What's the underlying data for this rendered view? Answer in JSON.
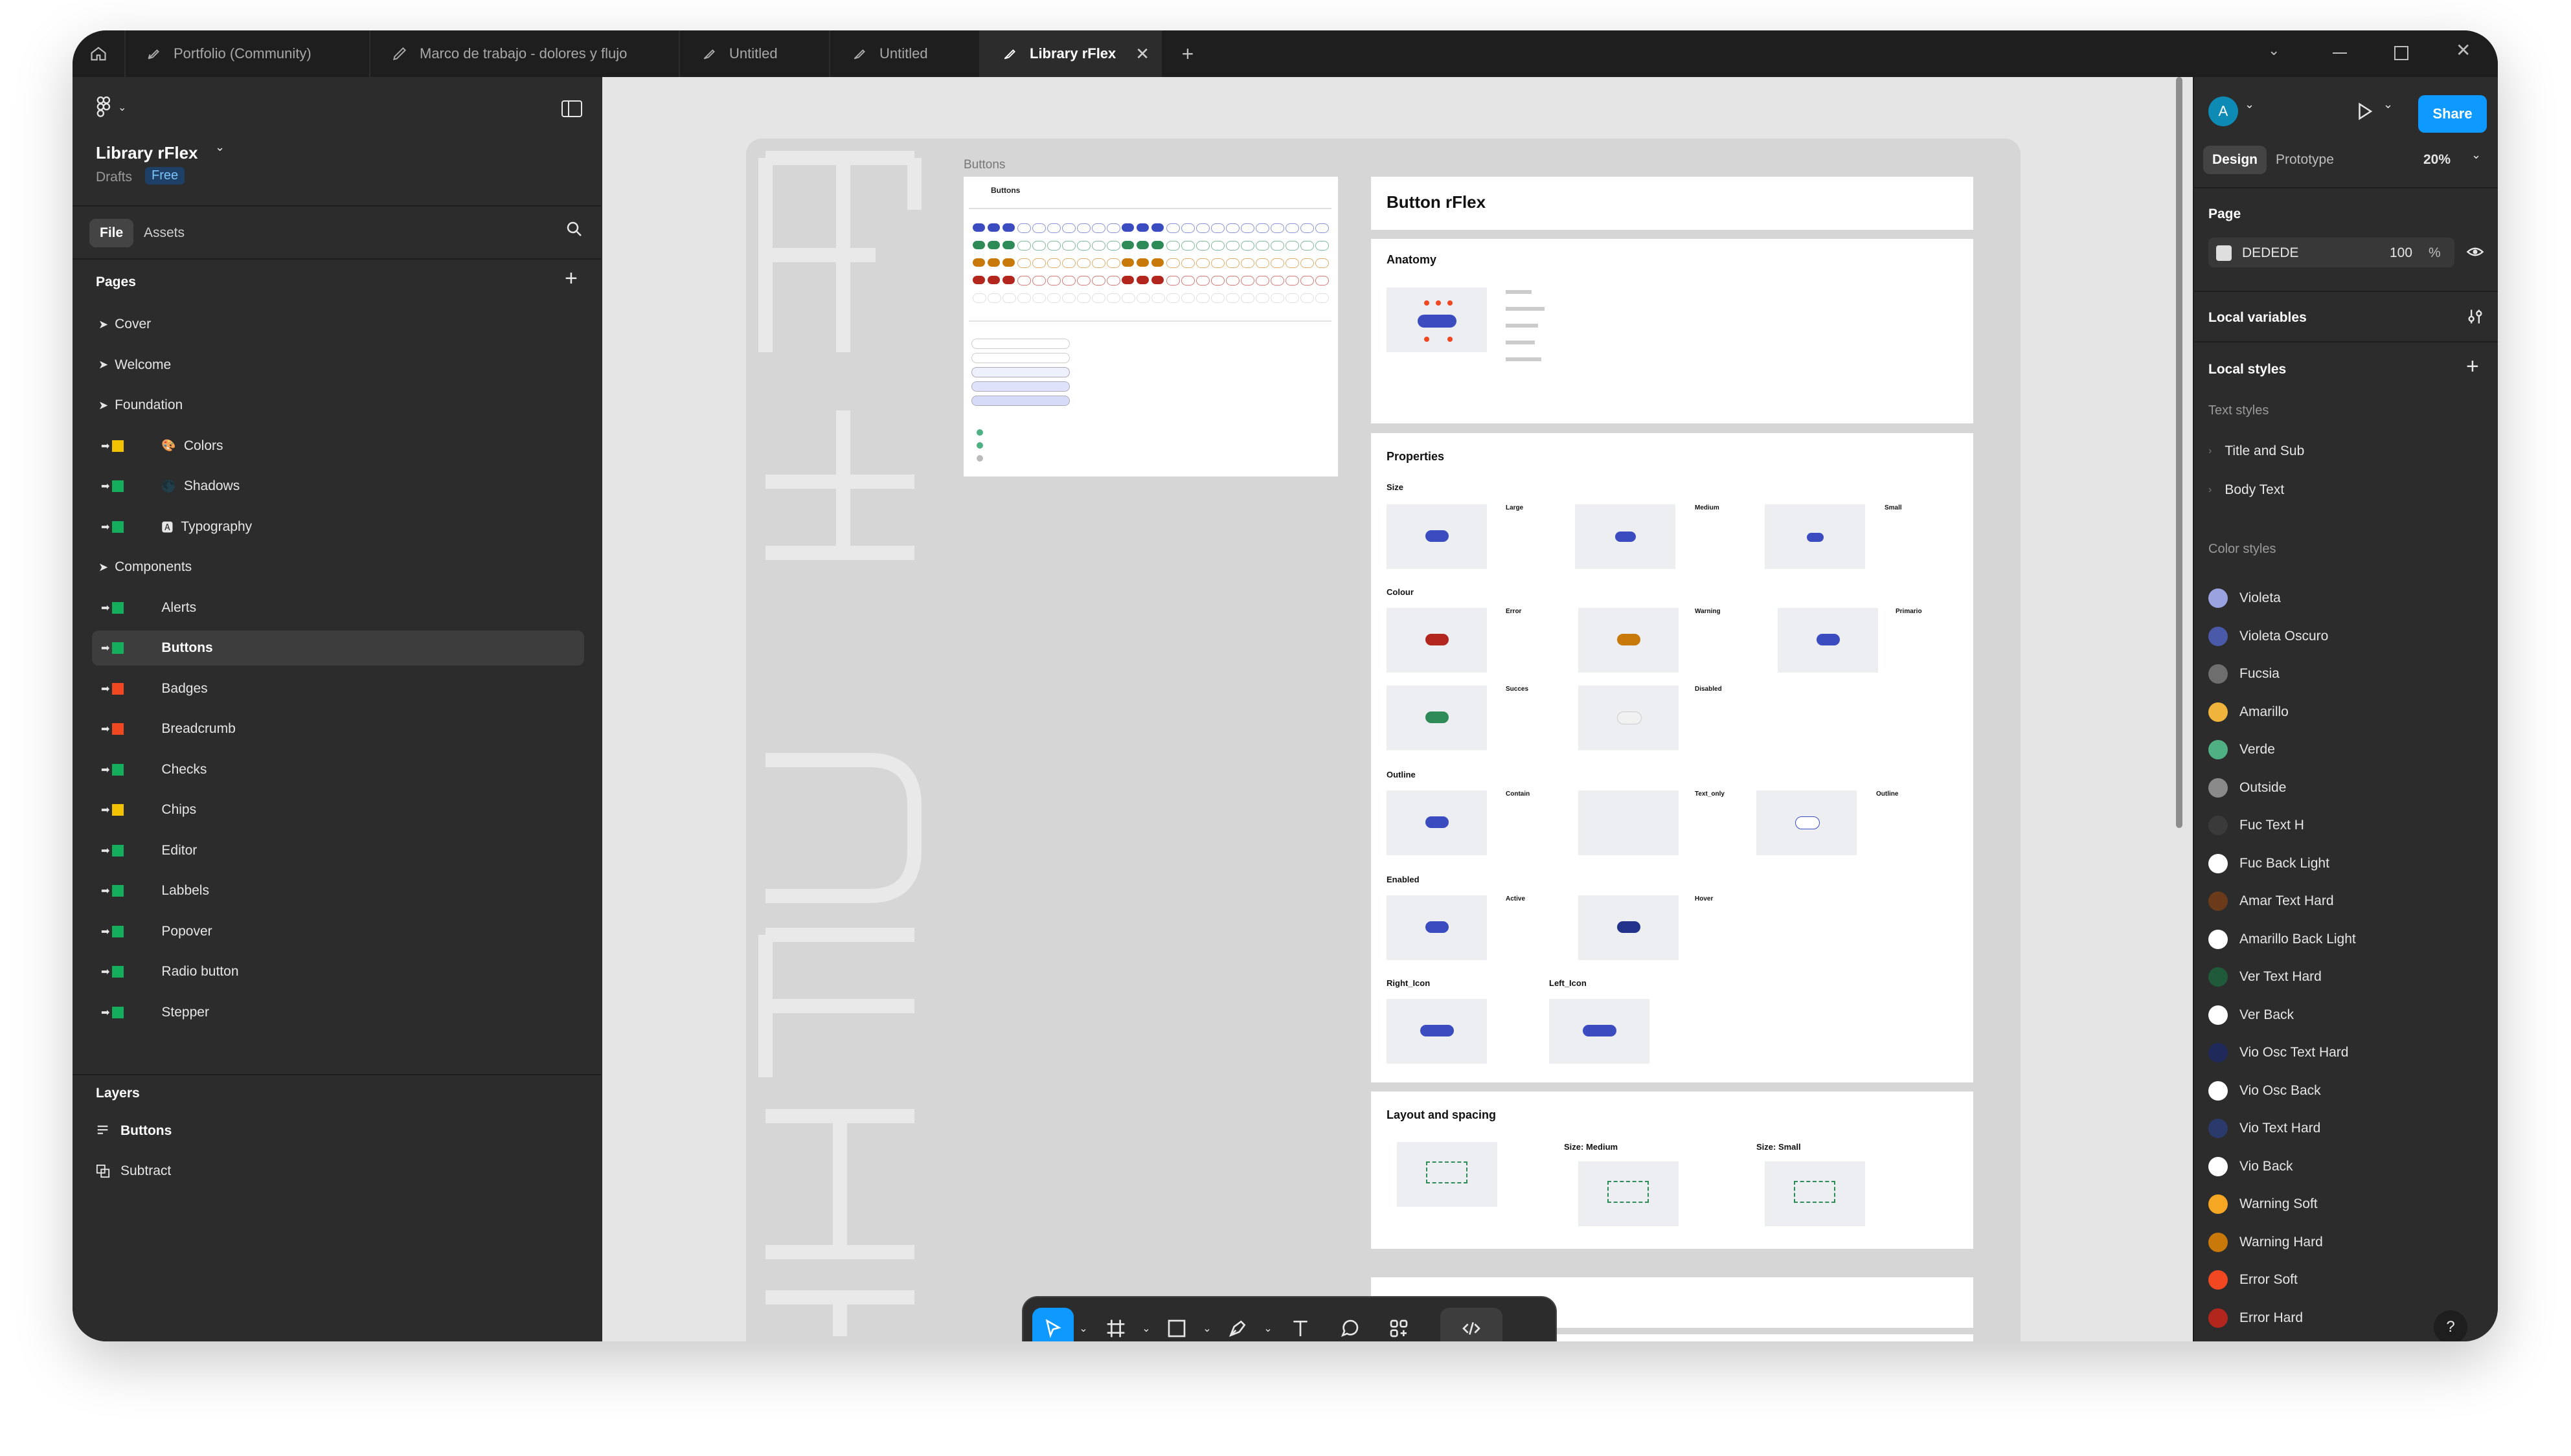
{
  "tabs": [
    {
      "label": "Portfolio (Community)"
    },
    {
      "label": "Marco de trabajo - dolores y flujo"
    },
    {
      "label": "Untitled"
    },
    {
      "label": "Untitled"
    },
    {
      "label": "Library rFlex"
    }
  ],
  "file": {
    "name": "Library rFlex",
    "location": "Drafts",
    "plan": "Free"
  },
  "left_tabs": {
    "file": "File",
    "assets": "Assets"
  },
  "pages_title": "Pages",
  "pages": [
    {
      "label": "Cover",
      "kind": "section"
    },
    {
      "label": "Welcome",
      "kind": "section"
    },
    {
      "label": "Foundation",
      "kind": "section"
    },
    {
      "label": "Colors",
      "kind": "page",
      "status": "#f2c200",
      "emoji": "🎨"
    },
    {
      "label": "Shadows",
      "kind": "page",
      "status": "#14ae5c",
      "emoji": "🌑"
    },
    {
      "label": "Typography",
      "kind": "page",
      "status": "#14ae5c",
      "emoji": "🅰"
    },
    {
      "label": "Components",
      "kind": "section"
    },
    {
      "label": "Alerts",
      "kind": "page",
      "status": "#14ae5c"
    },
    {
      "label": "Buttons",
      "kind": "page",
      "status": "#14ae5c",
      "selected": true
    },
    {
      "label": "Badges",
      "kind": "page",
      "status": "#f24822"
    },
    {
      "label": "Breadcrumb",
      "kind": "page",
      "status": "#f24822"
    },
    {
      "label": "Checks",
      "kind": "page",
      "status": "#14ae5c"
    },
    {
      "label": "Chips",
      "kind": "page",
      "status": "#f2c200"
    },
    {
      "label": "Editor",
      "kind": "page",
      "status": "#14ae5c"
    },
    {
      "label": "Labbels",
      "kind": "page",
      "status": "#14ae5c"
    },
    {
      "label": "Popover",
      "kind": "page",
      "status": "#14ae5c"
    },
    {
      "label": "Radio button",
      "kind": "page",
      "status": "#14ae5c"
    },
    {
      "label": "Stepper",
      "kind": "page",
      "status": "#14ae5c"
    }
  ],
  "layers_title": "Layers",
  "layers": [
    {
      "label": "Buttons",
      "icon": "frame-icon"
    },
    {
      "label": "Subtract",
      "icon": "boolean-icon"
    }
  ],
  "canvas": {
    "frame_label": "Buttons",
    "frame_title": "Buttons",
    "title_card": "Button rFlex",
    "sections": {
      "anatomy": "Anatomy",
      "properties": "Properties",
      "size": "Size",
      "colour": "Colour",
      "outline": "Outline",
      "enabled": "Enabled",
      "right_icon": "Right_Icon",
      "left_icon": "Left_Icon",
      "layout": "Layout and spacing",
      "size_medium": "Size: Medium",
      "size_small": "Size: Small"
    },
    "size_labels": [
      "Large",
      "Medium",
      "Small"
    ],
    "colour_labels": [
      "Error",
      "Warning",
      "Primario",
      "Succes",
      "Disabled"
    ],
    "outline_labels": [
      "Contain",
      "Text_only",
      "Outline"
    ],
    "enabled_labels": [
      "Active",
      "Hover"
    ]
  },
  "right": {
    "avatar": "A",
    "share": "Share",
    "design": "Design",
    "prototype": "Prototype",
    "zoom": "20%",
    "page_title": "Page",
    "page_color": "DEDEDE",
    "page_opacity": "100",
    "percent": "%",
    "local_variables": "Local variables",
    "local_styles": "Local styles",
    "text_styles_title": "Text styles",
    "text_styles": [
      "Title and Sub",
      "Body Text"
    ],
    "color_styles_title": "Color styles",
    "color_styles": [
      {
        "name": "Violeta",
        "color": "#9aa3e0"
      },
      {
        "name": "Violeta Oscuro",
        "color": "#4b5aa8"
      },
      {
        "name": "Fucsia",
        "color": "#6e6e6e"
      },
      {
        "name": "Amarillo",
        "color": "#f0b43c"
      },
      {
        "name": "Verde",
        "color": "#4fb084"
      },
      {
        "name": "Outside",
        "color": "#8a8a8a"
      },
      {
        "name": "Fuc Text H",
        "color": "#3a3a3a"
      },
      {
        "name": "Fuc Back Light",
        "color": "#ffffff"
      },
      {
        "name": "Amar Text Hard",
        "color": "#6a3a1a"
      },
      {
        "name": "Amarillo Back Light",
        "color": "#ffffff"
      },
      {
        "name": "Ver Text Hard",
        "color": "#1f5a3a"
      },
      {
        "name": "Ver Back",
        "color": "#ffffff"
      },
      {
        "name": "Vio Osc Text Hard",
        "color": "#1f2a5a"
      },
      {
        "name": "Vio Osc Back",
        "color": "#ffffff"
      },
      {
        "name": "Vio Text Hard",
        "color": "#2a3a6a"
      },
      {
        "name": "Vio Back",
        "color": "#ffffff"
      },
      {
        "name": "Warning Soft",
        "color": "#f5a623"
      },
      {
        "name": "Warning Hard",
        "color": "#c9780a"
      },
      {
        "name": "Error Soft",
        "color": "#f24822"
      },
      {
        "name": "Error Hard",
        "color": "#b3261e"
      }
    ]
  },
  "help": "?"
}
